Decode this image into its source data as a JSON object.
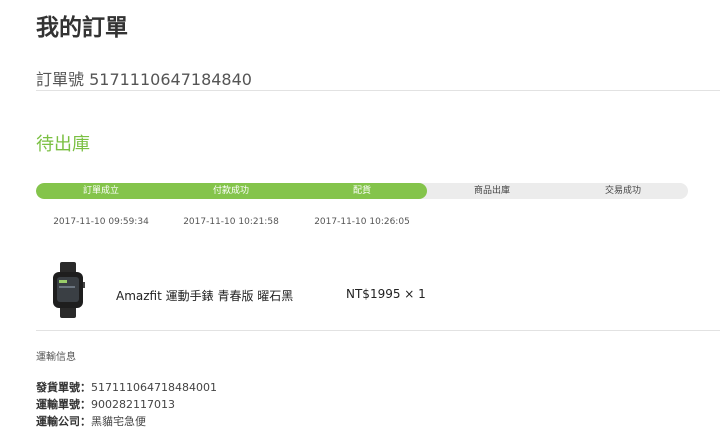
{
  "page": {
    "title": "我的訂單"
  },
  "order": {
    "number_text": "訂單號 5171110647184840",
    "status": "待出庫"
  },
  "progress": {
    "completed_steps": 3,
    "total_steps": 5,
    "steps": [
      {
        "label": "訂單成立",
        "time": "2017-11-10 09:59:34",
        "done": true
      },
      {
        "label": "付款成功",
        "time": "2017-11-10 10:21:58",
        "done": true
      },
      {
        "label": "配貨",
        "time": "2017-11-10 10:26:05",
        "done": true
      },
      {
        "label": "商品出庫",
        "time": "",
        "done": false
      },
      {
        "label": "交易成功",
        "time": "",
        "done": false
      }
    ]
  },
  "item": {
    "image_icon": "smartwatch-icon",
    "name": "Amazfit 運動手錶 青春版 曜石黑",
    "price": "NT$1995 × 1"
  },
  "shipping": {
    "heading": "運輸信息",
    "rows": [
      {
        "label": "發貨單號：",
        "value": "517111064718484001"
      },
      {
        "label": "運輸單號：",
        "value": "900282117013"
      },
      {
        "label": "運輸公司：",
        "value": "黑貓宅急便"
      }
    ]
  },
  "colors": {
    "accent": "#84c44b",
    "status_text": "#7bc043",
    "track": "#ececec"
  }
}
